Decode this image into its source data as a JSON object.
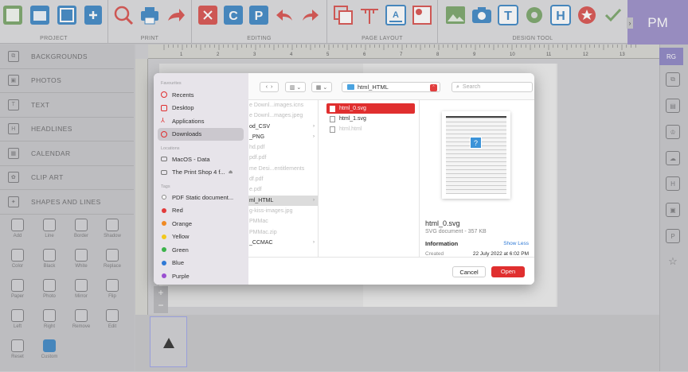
{
  "toolbar": {
    "groups": {
      "project": "PROJECT",
      "print": "PRINT",
      "editing": "EDITING",
      "page_layout": "PAGE LAYOUT",
      "design_tool": "DESIGN TOOL"
    },
    "icons": [
      "save-icon",
      "open-folder-icon",
      "export-icon",
      "new-project-icon",
      "zoom-icon",
      "print-icon",
      "share-icon",
      "cut-icon",
      "copy-icon",
      "paste-icon",
      "undo-icon",
      "redo-icon",
      "layers-icon",
      "ruler-icon",
      "text-layout-icon",
      "frame-icon",
      "image-icon",
      "camera-icon",
      "text-tool-icon",
      "gear-icon",
      "headline-icon",
      "star-icon",
      "check-icon"
    ],
    "profile": "PM"
  },
  "sidebar": {
    "items": [
      {
        "label": "BACKGROUNDS",
        "icon": "backgrounds-icon"
      },
      {
        "label": "PHOTOS",
        "icon": "photo-icon"
      },
      {
        "label": "TEXT",
        "icon": "text-icon"
      },
      {
        "label": "HEADLINES",
        "icon": "headline-icon"
      },
      {
        "label": "CALENDAR",
        "icon": "calendar-icon"
      },
      {
        "label": "CLIP ART",
        "icon": "clip-art-icon"
      },
      {
        "label": "SHAPES AND LINES",
        "icon": "shapes-icon"
      }
    ],
    "tools": [
      {
        "label": "Add"
      },
      {
        "label": "Line"
      },
      {
        "label": "Border"
      },
      {
        "label": "Shadow"
      },
      {
        "label": "Color"
      },
      {
        "label": "Black"
      },
      {
        "label": "White"
      },
      {
        "label": "Replace"
      },
      {
        "label": "Paper"
      },
      {
        "label": "Photo"
      },
      {
        "label": "Mirror"
      },
      {
        "label": "Flip"
      },
      {
        "label": "Left"
      },
      {
        "label": "Right"
      },
      {
        "label": "Remove"
      },
      {
        "label": "Edit"
      },
      {
        "label": "Reset"
      },
      {
        "label": "Custom"
      }
    ]
  },
  "ruler": {
    "ticks": [
      "1",
      "2",
      "3",
      "4",
      "5",
      "6",
      "7",
      "8",
      "9",
      "10",
      "11",
      "12",
      "13"
    ]
  },
  "right_panel": {
    "badge": "RG"
  },
  "dialog": {
    "favourites_heading": "Favourites",
    "favourites": [
      {
        "label": "Recents",
        "color": "#e02f2f"
      },
      {
        "label": "Desktop",
        "color": "#e02f2f"
      },
      {
        "label": "Applications",
        "color": "#e02f2f"
      },
      {
        "label": "Downloads",
        "color": "#e02f2f"
      }
    ],
    "locations_heading": "Locations",
    "locations": [
      {
        "label": "MacOS - Data"
      },
      {
        "label": "The Print Shop 4 f..."
      }
    ],
    "tags_heading": "Tags",
    "tags": [
      {
        "label": "PDF Static document...",
        "color": "#ffffff"
      },
      {
        "label": "Red",
        "color": "#e23b3b"
      },
      {
        "label": "Orange",
        "color": "#f08a24"
      },
      {
        "label": "Yellow",
        "color": "#f2c81e"
      },
      {
        "label": "Green",
        "color": "#3bb34a"
      },
      {
        "label": "Blue",
        "color": "#2f7ad6"
      },
      {
        "label": "Purple",
        "color": "#9a4fd1"
      }
    ],
    "path": "html_HTML",
    "search_placeholder": "Search",
    "column1": [
      {
        "label": "e Downl...images.icns",
        "state": "grey"
      },
      {
        "label": "e Downl...mages.jpeg",
        "state": "grey"
      },
      {
        "label": "od_CSV",
        "state": "normal",
        "arrow": true
      },
      {
        "label": "_PNG",
        "state": "normal",
        "arrow": true
      },
      {
        "label": "hd.pdf",
        "state": "grey"
      },
      {
        "label": "pdf.pdf",
        "state": "grey"
      },
      {
        "label": "me Desi...entitlements",
        "state": "grey"
      },
      {
        "label": "df.pdf",
        "state": "grey"
      },
      {
        "label": "e.pdf",
        "state": "grey"
      },
      {
        "label": "ml_HTML",
        "state": "selected",
        "arrow": true
      },
      {
        "label": "g-kiss-images.jpg",
        "state": "grey"
      },
      {
        "label": "PMMac",
        "state": "grey"
      },
      {
        "label": "PMMac.zip",
        "state": "grey"
      },
      {
        "label": "_CCMAC",
        "state": "normal",
        "arrow": true
      }
    ],
    "column2": [
      {
        "label": "html_0.svg",
        "state": "selected"
      },
      {
        "label": "html_1.svg",
        "state": "normal"
      },
      {
        "label": "html.html",
        "state": "grey"
      }
    ],
    "preview": {
      "name": "html_0.svg",
      "kind": "SVG document - 357 KB",
      "info_heading": "Information",
      "show_less": "Show Less",
      "created_label": "Created",
      "created_value": "22 July 2022 at 6:02 PM"
    },
    "cancel": "Cancel",
    "open": "Open"
  }
}
